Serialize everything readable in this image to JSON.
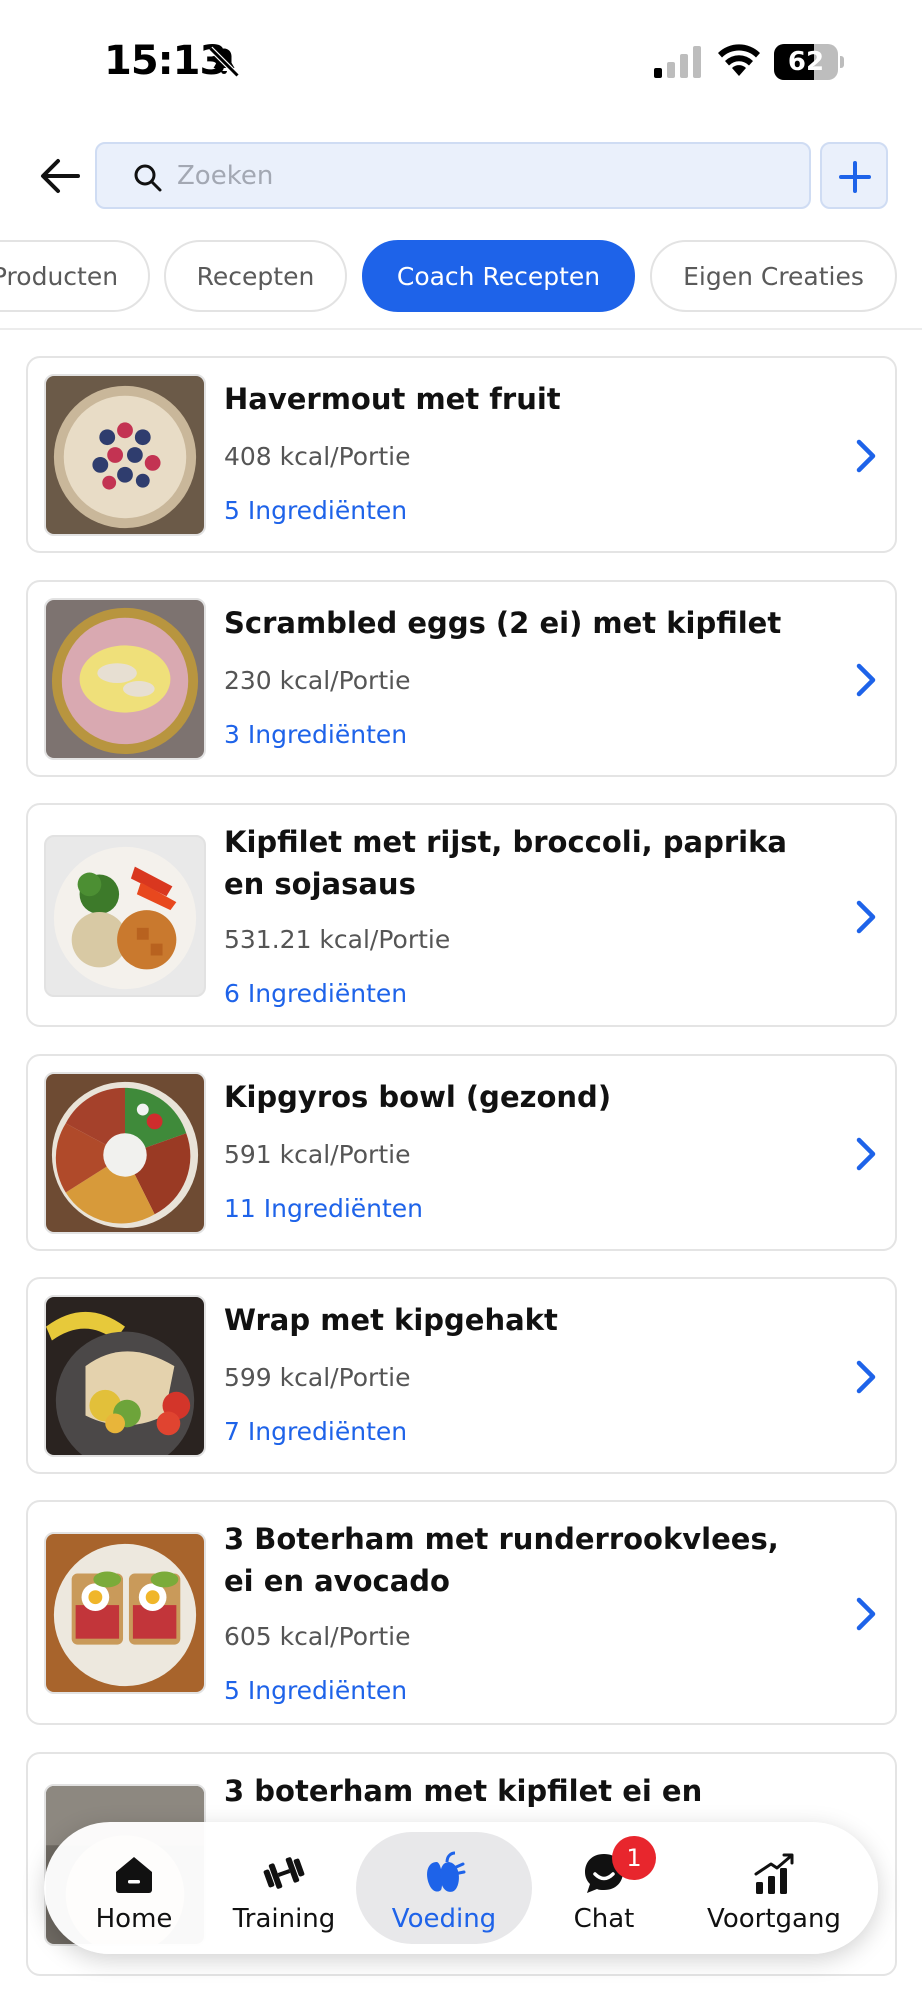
{
  "status_bar": {
    "time": "15:13",
    "battery": "62",
    "battery_level": 0.62,
    "icons": [
      "bell-slash-icon",
      "cellular-signal-icon",
      "wifi-icon",
      "battery-icon"
    ]
  },
  "header": {
    "search_placeholder": "Zoeken",
    "search_value": "",
    "back_icon": "arrow-left-icon",
    "add_icon": "plus-icon"
  },
  "tabs": [
    {
      "label": "Producten",
      "active": false
    },
    {
      "label": "Recepten",
      "active": false
    },
    {
      "label": "Coach Recepten",
      "active": true
    },
    {
      "label": "Eigen Creaties",
      "active": false
    }
  ],
  "recipes": [
    {
      "title": "Havermout met fruit",
      "kcal": "408 kcal/Portie",
      "ingredients": "5 Ingrediënten"
    },
    {
      "title": "Scrambled eggs (2 ei)  met kipfilet",
      "kcal": "230 kcal/Portie",
      "ingredients": "3 Ingrediënten"
    },
    {
      "title": "Kipfilet met rijst, broccoli, paprika en sojasaus",
      "kcal": "531.21 kcal/Portie",
      "ingredients": "6 Ingrediënten"
    },
    {
      "title": "Kipgyros bowl  (gezond)",
      "kcal": "591 kcal/Portie",
      "ingredients": "11 Ingrediënten"
    },
    {
      "title": "Wrap met kipgehakt",
      "kcal": "599 kcal/Portie",
      "ingredients": "7 Ingrediënten"
    },
    {
      "title": "3 Boterham met runderrookvlees, ei en avocado",
      "kcal": "605 kcal/Portie",
      "ingredients": "5 Ingrediënten"
    },
    {
      "title": "3 boterham met kipfilet ei en",
      "kcal": "",
      "ingredients": ""
    }
  ],
  "bottom_nav": [
    {
      "label": "Home",
      "icon": "home-icon",
      "active": false
    },
    {
      "label": "Training",
      "icon": "dumbbell-icon",
      "active": false
    },
    {
      "label": "Voeding",
      "icon": "food-icon",
      "active": true
    },
    {
      "label": "Chat",
      "icon": "chat-icon",
      "active": false,
      "badge": "1"
    },
    {
      "label": "Voortgang",
      "icon": "progress-chart-icon",
      "active": false
    }
  ],
  "colors": {
    "accent": "#1e63e9",
    "badge": "#e8262d",
    "card_border": "#e4e4e4",
    "search_bg": "#eaf0fb"
  }
}
